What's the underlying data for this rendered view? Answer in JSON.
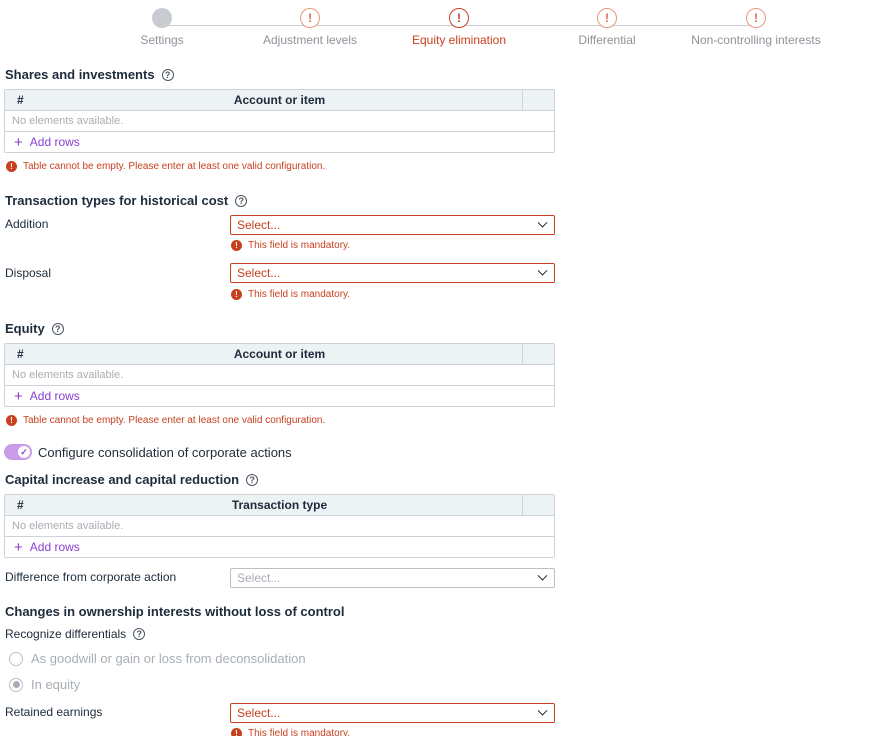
{
  "stepper": {
    "steps": [
      {
        "label": "Settings",
        "state": "done",
        "icon": ""
      },
      {
        "label": "Adjustment levels",
        "state": "warn",
        "icon": "!"
      },
      {
        "label": "Equity elimination",
        "state": "active",
        "icon": "!"
      },
      {
        "label": "Differential",
        "state": "warn",
        "icon": "!"
      },
      {
        "label": "Non-controlling interests",
        "state": "warn",
        "icon": "!"
      }
    ]
  },
  "shares": {
    "title": "Shares and investments",
    "help_icon": "?",
    "table": {
      "col_num": "#",
      "col_main": "Account or item",
      "empty": "No elements available.",
      "add_label": "Add rows",
      "add_icon": "+"
    },
    "error": "Table cannot be empty. Please enter at least one valid configuration."
  },
  "transaction_types": {
    "title": "Transaction types for historical cost",
    "help_icon": "?",
    "addition": {
      "label": "Addition",
      "placeholder": "Select...",
      "error": "This field is mandatory."
    },
    "disposal": {
      "label": "Disposal",
      "placeholder": "Select...",
      "error": "This field is mandatory."
    }
  },
  "equity": {
    "title": "Equity",
    "help_icon": "?",
    "table": {
      "col_num": "#",
      "col_main": "Account or item",
      "empty": "No elements available.",
      "add_label": "Add rows",
      "add_icon": "+"
    },
    "error": "Table cannot be empty. Please enter at least one valid configuration."
  },
  "corporate_actions": {
    "toggle_label": "Configure consolidation of corporate actions",
    "toggle_on": true,
    "toggle_check": "✓"
  },
  "capital": {
    "title": "Capital increase and capital reduction",
    "help_icon": "?",
    "table": {
      "col_num": "#",
      "col_main": "Transaction type",
      "empty": "No elements available.",
      "add_label": "Add rows",
      "add_icon": "+"
    },
    "difference": {
      "label": "Difference from corporate action",
      "placeholder": "Select..."
    }
  },
  "ownership": {
    "title": "Changes in ownership interests without loss of control",
    "recognize_label": "Recognize differentials",
    "help_icon": "?",
    "option_goodwill": "As goodwill or gain or loss from deconsolidation",
    "option_equity": "In equity",
    "selected": "In equity",
    "retained": {
      "label": "Retained earnings",
      "placeholder": "Select...",
      "error": "This field is mandatory."
    }
  },
  "error_icon": "!",
  "colors": {
    "accent": "#8a3fd1",
    "error": "#c8401f",
    "warn": "#e8977f"
  }
}
